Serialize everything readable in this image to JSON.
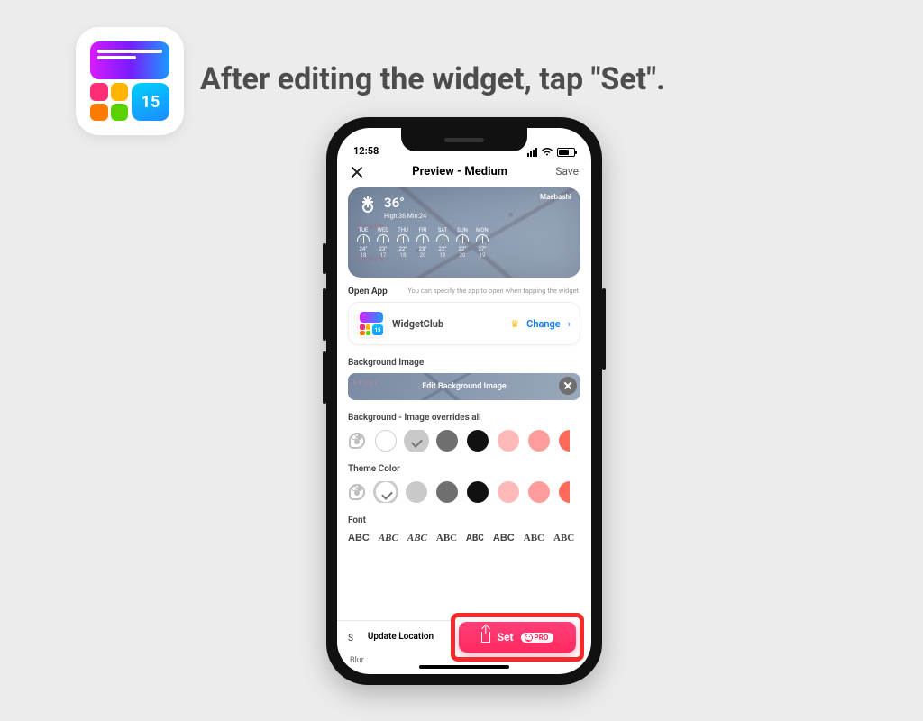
{
  "app_icon": {
    "badge": "15"
  },
  "headline": "After editing the widget, tap \"Set\".",
  "status": {
    "time": "12:58"
  },
  "nav": {
    "title": "Preview - Medium",
    "save": "Save"
  },
  "widget": {
    "location": "Maebashi",
    "temp": "36°",
    "hi_lo": "High:36 Min:24",
    "caption1": "STUDY",
    "caption2": "LANEK",
    "days": [
      {
        "d": "TUE",
        "t": "24°",
        "p": "18"
      },
      {
        "d": "WED",
        "t": "23°",
        "p": "17"
      },
      {
        "d": "THU",
        "t": "22°",
        "p": "18"
      },
      {
        "d": "FRI",
        "t": "23°",
        "p": "20"
      },
      {
        "d": "SAT",
        "t": "22°",
        "p": "19"
      },
      {
        "d": "SUN",
        "t": "22°",
        "p": "20"
      },
      {
        "d": "MON",
        "t": "27°",
        "p": "19"
      }
    ]
  },
  "open_app": {
    "label": "Open App",
    "help": "You can specify the app to open when tapping the widget.",
    "app_name": "WidgetClub",
    "mini_badge": "15",
    "change": "Change"
  },
  "bg_image": {
    "label": "Background Image",
    "button": "Edit Background Image",
    "cap": "STUDY"
  },
  "bg_color": {
    "label": "Background - Image overrides all",
    "swatches": [
      "#ffffff",
      "#c9c9c9",
      "#6f6f6f",
      "#111111",
      "#ffb9b9",
      "#ff9d9d",
      "#ff6a5a"
    ],
    "selected": 1
  },
  "theme_color": {
    "label": "Theme Color",
    "swatches": [
      "#ffffff",
      "#c9c9c9",
      "#6f6f6f",
      "#111111",
      "#ffb9b9",
      "#ff9d9d",
      "#ff6a5a"
    ],
    "selected": 0
  },
  "font": {
    "label": "Font",
    "items": [
      "ABC",
      "ABC",
      "ABC",
      "ABC",
      "ABC",
      "ABC",
      "ABC",
      "ABC"
    ],
    "families": [
      "Arial",
      "Georgia",
      "'Times New Roman'",
      "'Comic Sans MS', cursive",
      "'Courier New', monospace",
      "Helvetica",
      "Impact",
      "Verdana"
    ]
  },
  "bottom": {
    "update": "Update Location",
    "set": "Set",
    "pro": "PRO",
    "blur": "Blur"
  }
}
